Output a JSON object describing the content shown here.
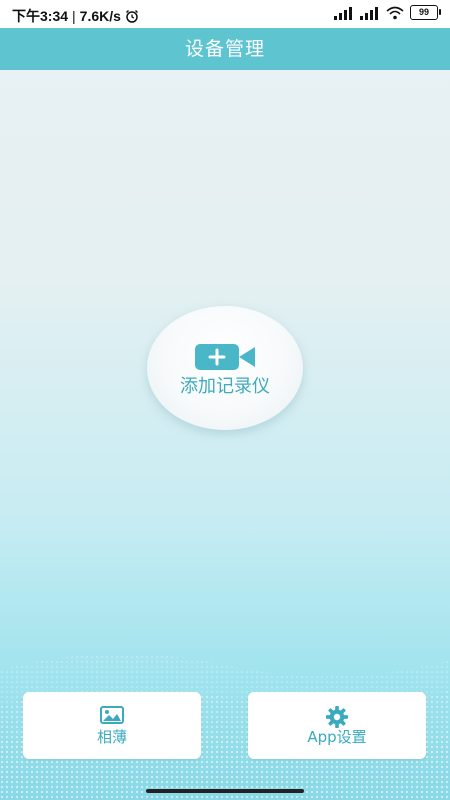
{
  "status_bar": {
    "time": "下午3:34",
    "separator": "|",
    "net_speed": "7.6K/s",
    "battery": "99"
  },
  "header": {
    "title": "设备管理"
  },
  "main": {
    "add_recorder_label": "添加记录仪"
  },
  "bottom_bar": {
    "album_label": "相薄",
    "settings_label": "App设置"
  },
  "colors": {
    "accent": "#5ec4d0",
    "label": "#3aaabf"
  },
  "icons": {
    "alarm": "alarm-clock-icon",
    "signal": "signal-icon",
    "wifi": "wifi-icon",
    "battery": "battery-icon",
    "camera_add": "video-camera-plus-icon",
    "album": "image-icon",
    "settings": "gear-icon"
  }
}
